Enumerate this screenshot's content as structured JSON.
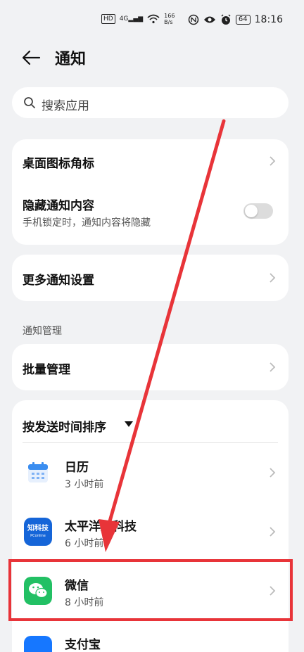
{
  "status_bar": {
    "hd": "HD",
    "net": "4G",
    "speed_value": "166",
    "speed_unit": "B/s",
    "battery": "64",
    "time": "18:16"
  },
  "header": {
    "title": "通知"
  },
  "search": {
    "placeholder": "搜索应用"
  },
  "settings": {
    "badge": "桌面图标角标",
    "hide_content": {
      "label": "隐藏通知内容",
      "sub": "手机锁定时，通知内容将隐藏",
      "enabled": false
    },
    "more": "更多通知设置"
  },
  "section": {
    "title": "通知管理"
  },
  "batch": "批量管理",
  "sort": {
    "label": "按发送时间排序"
  },
  "apps": [
    {
      "name": "日历",
      "time": "3 小时前",
      "icon": "calendar-icon"
    },
    {
      "name": "太平洋知科技",
      "time": "6 小时前",
      "icon": "zhikeji-icon",
      "icon_text": "知科技",
      "icon_sub": "PConline"
    },
    {
      "name": "微信",
      "time": "8 小时前",
      "icon": "wechat-icon"
    },
    {
      "name": "支付宝",
      "time": "",
      "icon": "alipay-icon"
    }
  ],
  "colors": {
    "accent_red": "#e83439",
    "wechat_green": "#22c064",
    "calendar_blue": "#3a8df0",
    "zhikeji_blue": "#1565d8"
  }
}
